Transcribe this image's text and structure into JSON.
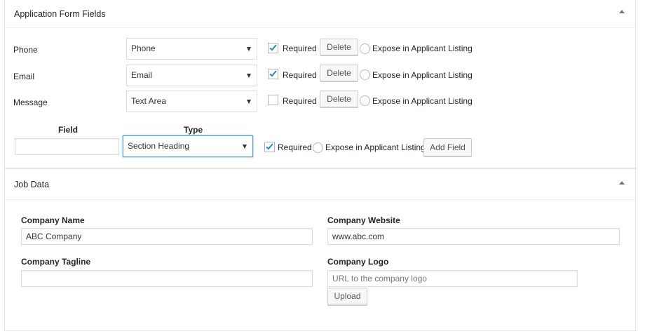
{
  "application_form": {
    "title": "Application Form Fields",
    "rows": [
      {
        "field": "Phone",
        "type": "Phone",
        "required_label": "Required",
        "required": true,
        "delete_label": "Delete",
        "expose_label": "Expose in Applicant Listing"
      },
      {
        "field": "Email",
        "type": "Email",
        "required_label": "Required",
        "required": true,
        "delete_label": "Delete",
        "expose_label": "Expose in Applicant Listing"
      },
      {
        "field": "Message",
        "type": "Text Area",
        "required_label": "Required",
        "required": false,
        "delete_label": "Delete",
        "expose_label": "Expose in Applicant Listing"
      }
    ],
    "new_field": {
      "field_header": "Field",
      "type_header": "Type",
      "field_value": "",
      "type_value": "Section Heading",
      "required_label": "Required",
      "required": true,
      "expose_label": "Expose in Applicant Listing",
      "add_label": "Add Field"
    }
  },
  "job_data": {
    "title": "Job Data",
    "company_name_label": "Company Name",
    "company_name_value": "ABC Company",
    "company_website_label": "Company Website",
    "company_website_value": "www.abc.com",
    "company_tagline_label": "Company Tagline",
    "company_tagline_value": "",
    "company_logo_label": "Company Logo",
    "company_logo_placeholder": "URL to the company logo",
    "upload_label": "Upload"
  },
  "colors": {
    "accent": "#1e8cbe",
    "focus_border": "#5b9dd9",
    "border": "#e5e5e5"
  }
}
